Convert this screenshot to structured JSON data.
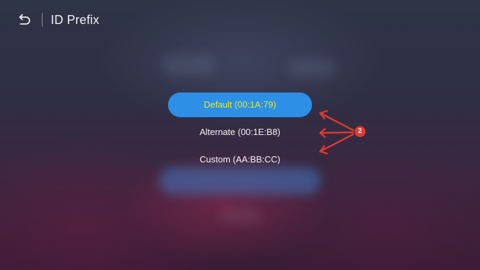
{
  "header": {
    "back_icon": "back-arrow-icon",
    "title": "ID Prefix"
  },
  "options": [
    {
      "label": "Default (00:1A:79)",
      "selected": true
    },
    {
      "label": "Alternate (00:1E:B8)",
      "selected": false
    },
    {
      "label": "Custom (AA:BB:CC)",
      "selected": false
    }
  ],
  "annotation": {
    "badge": "2",
    "color": "#e03a2e"
  },
  "colors": {
    "selected_background": "#2d8fe6",
    "selected_text": "#eaea2a"
  }
}
